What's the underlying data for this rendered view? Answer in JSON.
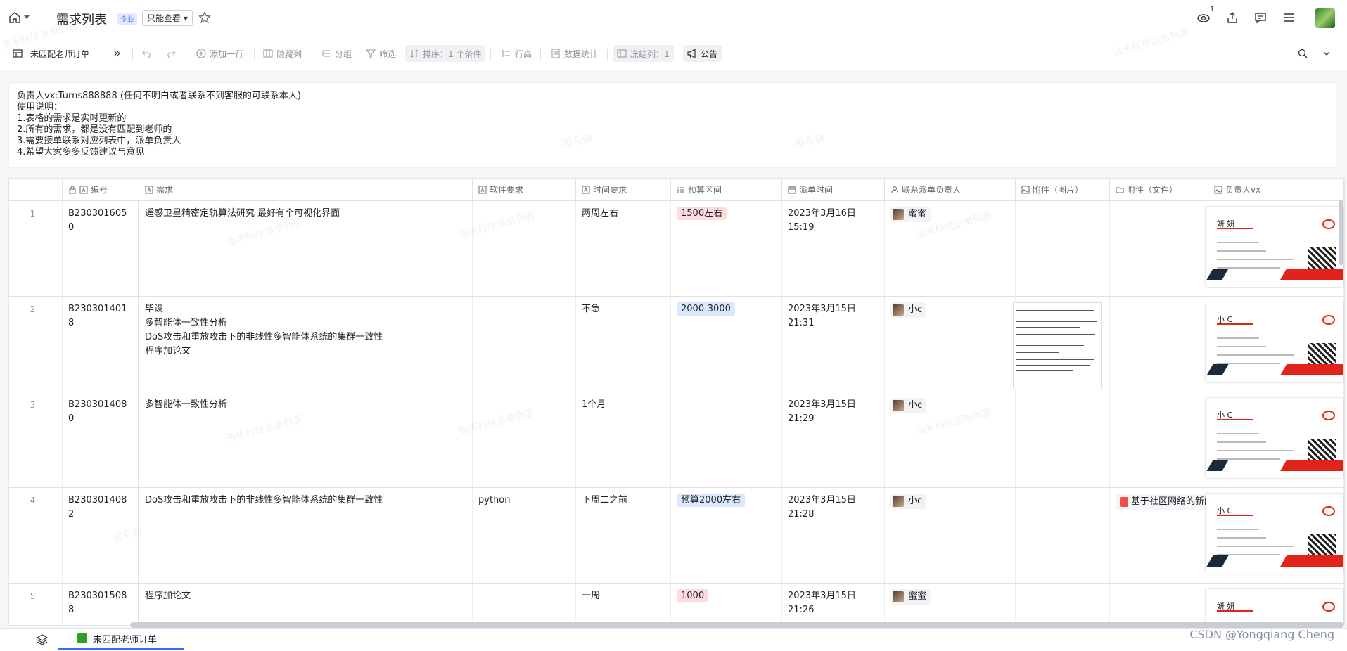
{
  "header": {
    "title": "需求列表",
    "enterprise_badge": "企业",
    "permission": "只能查看",
    "eye_count": "1"
  },
  "toolbar": {
    "view_name": "未匹配老师订单",
    "add_row": "添加一行",
    "hide_cols": "隐藏列",
    "group": "分组",
    "filter": "筛选",
    "sort": "排序：1 个条件",
    "row_height": "行高",
    "stats": "数据统计",
    "freeze": "冻结列：1",
    "announcement": "公告"
  },
  "notice": {
    "lines": [
      "负责人vx:Turns888888 (任何不明白或者联系不到客服的可联系本人)",
      "使用说明：",
      "1.表格的需求是实时更新的",
      "2.所有的需求，都是没有匹配到老师的",
      "3.需要接单联系对应列表中，派单负责人",
      "4.希望大家多多反馈建议与意见"
    ]
  },
  "columns": {
    "id": "编号",
    "requirement": "需求",
    "software": "软件要求",
    "time_req": "时间要求",
    "budget": "预算区间",
    "dispatch_time": "派单时间",
    "contact": "联系派单负责人",
    "attach_img": "附件（图片）",
    "attach_file": "附件（文件）",
    "owner_vx": "负责人vx"
  },
  "rows": [
    {
      "num": "1",
      "id_line1": "B230301605",
      "id_line2": "0",
      "req": [
        "遥感卫星精密定轨算法研究 最好有个可视化界面"
      ],
      "software": "",
      "time": "两周左右",
      "budget": "1500左右",
      "budget_color": "#fcdcdc",
      "dispatch": "2023年3月16日 15:19",
      "contact": "蜜蜜",
      "file": "",
      "card_name": "妍 妍"
    },
    {
      "num": "2",
      "id_line1": "B230301401",
      "id_line2": "8",
      "req": [
        "毕设",
        "多智能体一致性分析",
        "DoS攻击和重放攻击下的非线性多智能体系统的集群一致性",
        "程序加论文"
      ],
      "software": "",
      "time": "不急",
      "budget": "2000-3000",
      "budget_color": "#dbe8fc",
      "dispatch": "2023年3月15日 21:31",
      "contact": "小c",
      "file": "",
      "card_name": "小 C"
    },
    {
      "num": "3",
      "id_line1": "B230301408",
      "id_line2": "0",
      "req": [
        "多智能体一致性分析"
      ],
      "software": "",
      "time": "1个月",
      "budget": "",
      "budget_color": "",
      "dispatch": "2023年3月15日 21:29",
      "contact": "小c",
      "file": "",
      "card_name": "小 C"
    },
    {
      "num": "4",
      "id_line1": "B230301408",
      "id_line2": "2",
      "req": [
        "DoS攻击和重放攻击下的非线性多智能体系统的集群一致性"
      ],
      "software": "python",
      "time": "下周二之前",
      "budget": "预算2000左右",
      "budget_color": "#dbe8fc",
      "dispatch": "2023年3月15日 21:28",
      "contact": "小c",
      "file": "基于社区网络的新闻",
      "card_name": "小 C"
    },
    {
      "num": "5",
      "id_line1": "B230301508",
      "id_line2": "8",
      "req": [
        "程序加论文"
      ],
      "software": "",
      "time": "一周",
      "budget": "1000",
      "budget_color": "#fcdcdc",
      "dispatch": "2023年3月15日 21:26",
      "contact": "蜜蜜",
      "file": "",
      "card_name": "妍 妍"
    }
  ],
  "bottom": {
    "sheet_tab": "未匹配老师订单",
    "watermark_credit": "CSDN @Yongqiang Cheng"
  },
  "watermark_text": "浩禾科技派单列表",
  "watermark_text2": "程永强"
}
